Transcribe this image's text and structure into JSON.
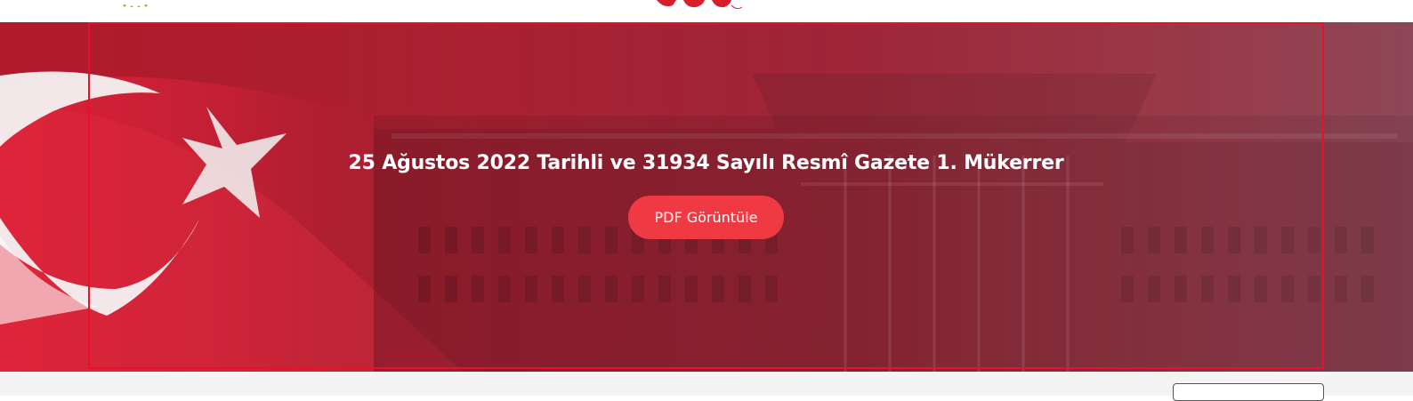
{
  "hero": {
    "title": "25 Ağustos 2022 Tarihli ve 31934 Sayılı Resmî Gazete 1. Mükerrer",
    "pdf_button_label": "PDF Görüntüle"
  },
  "colors": {
    "hero_red": "#a8182a",
    "frame_red": "#e8102a",
    "button_red": "#ef3a44",
    "flag_white": "#f4f2f2"
  },
  "icons": {
    "left_logo": "emblem-stars-icon",
    "center_logo": "anniversary-100-logo"
  }
}
